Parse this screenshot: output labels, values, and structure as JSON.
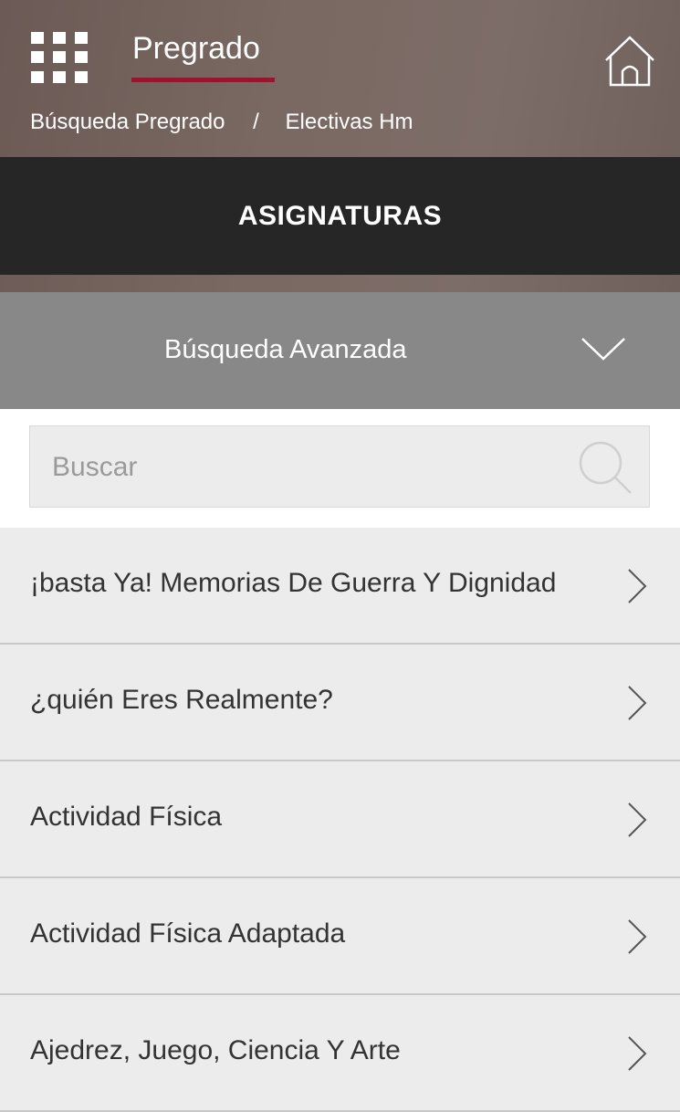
{
  "header": {
    "title": "Pregrado",
    "breadcrumb": {
      "first": "Búsqueda Pregrado",
      "separator": "/",
      "second": "Electivas Hm"
    },
    "icons": {
      "menu": "apps-grid-icon",
      "home": "home-icon"
    },
    "accent_color": "#a0122b"
  },
  "section": {
    "title": "ASIGNATURAS"
  },
  "advanced_search": {
    "label": "Búsqueda Avanzada",
    "icon": "chevron-down-icon"
  },
  "search": {
    "placeholder": "Buscar",
    "value": "",
    "icon": "search-icon"
  },
  "subjects": [
    {
      "name": "¡basta Ya! Memorias De Guerra Y Dignidad"
    },
    {
      "name": "¿quién Eres Realmente?"
    },
    {
      "name": "Actividad Física"
    },
    {
      "name": "Actividad Física Adaptada"
    },
    {
      "name": "Ajedrez, Juego, Ciencia Y Arte"
    }
  ]
}
